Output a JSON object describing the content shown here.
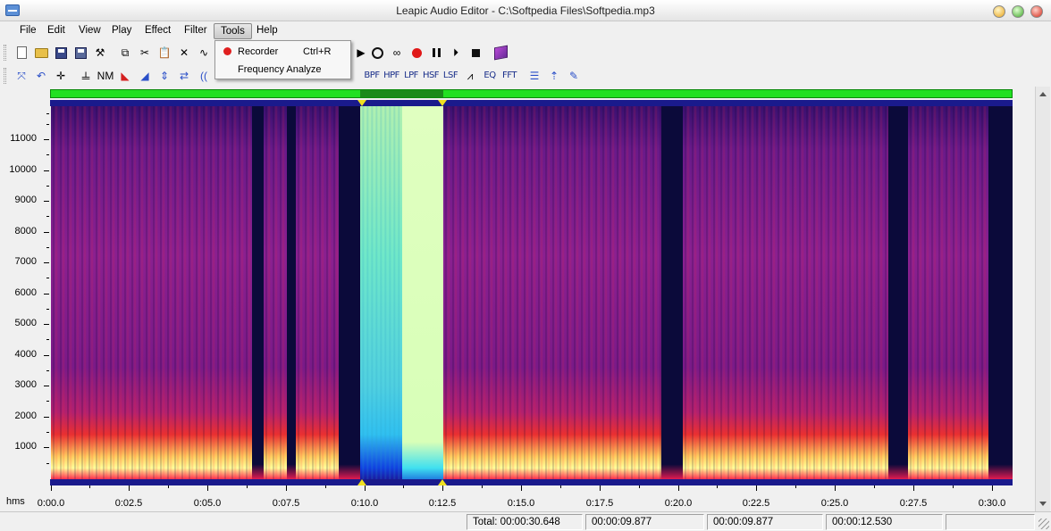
{
  "window": {
    "title": "Leapic Audio Editor - C:\\Softpedia Files\\Softpedia.mp3"
  },
  "menu": {
    "items": [
      "File",
      "Edit",
      "View",
      "Play",
      "Effect",
      "Filter",
      "Tools",
      "Help"
    ],
    "active": "Tools"
  },
  "tools_menu": {
    "items": [
      {
        "label": "Recorder",
        "shortcut": "Ctrl+R",
        "icon": "record-icon"
      },
      {
        "label": "Frequency Analyze",
        "shortcut": "",
        "icon": ""
      }
    ]
  },
  "toolbar2": {
    "filter_buttons": [
      "BPF",
      "HPF",
      "LPF",
      "HSF",
      "LSF",
      "EQ",
      "FFT"
    ]
  },
  "spectrogram": {
    "y_labels": [
      "11000",
      "10000",
      "9000",
      "8000",
      "7000",
      "6000",
      "5000",
      "4000",
      "3000",
      "2000",
      "1000"
    ],
    "x_unit_label": "hms",
    "x_labels": [
      "0:00.0",
      "0:02.5",
      "0:05.0",
      "0:07.5",
      "0:10.0",
      "0:12.5",
      "0:15.0",
      "0:17.5",
      "0:20.0",
      "0:22.5",
      "0:25.0",
      "0:27.5",
      "0:30.0"
    ],
    "selection": {
      "start": "00:00:09.877",
      "end": "00:00:12.530"
    },
    "colors": {
      "background": "#0b0a3a",
      "overview": "#22e022",
      "marker": "#f0e020"
    }
  },
  "status": {
    "total": "Total: 00:00:30.648",
    "cursor": "00:00:09.877",
    "sel_start": "00:00:09.877",
    "sel_end": "00:00:12.530"
  }
}
